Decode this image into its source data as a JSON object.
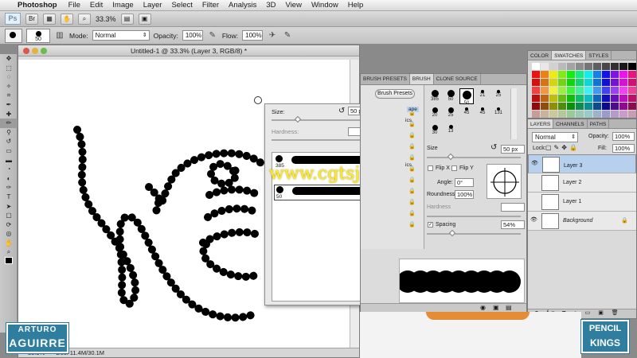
{
  "menubar": {
    "apple": "",
    "app_name": "Photoshop",
    "items": [
      "File",
      "Edit",
      "Image",
      "Layer",
      "Select",
      "Filter",
      "Analysis",
      "3D",
      "View",
      "Window",
      "Help"
    ]
  },
  "appbar": {
    "logo": "Ps",
    "zoom": "33.3%"
  },
  "options": {
    "brush_size": "50",
    "mode_label": "Mode:",
    "mode_value": "Normal",
    "opacity_label": "Opacity:",
    "opacity_value": "100%",
    "flow_label": "Flow:",
    "flow_value": "100%"
  },
  "document": {
    "title": "Untitled-1 @ 33.3% (Layer 3, RGB/8) *",
    "status_zoom": "33.3%",
    "status_doc": "Doc: 11.4M/30.1M"
  },
  "picker": {
    "size_label": "Size:",
    "size_value": "50 px",
    "hardness_label": "Hardness:",
    "presets": [
      {
        "num": "385"
      },
      {
        "num": "50"
      }
    ]
  },
  "brush_panel": {
    "tabs": [
      "BRUSH PRESETS",
      "BRUSH",
      "CLONE SOURCE"
    ],
    "presets_button": "Brush Presets",
    "side_fragments": [
      "ape",
      "ics",
      "ics"
    ],
    "thumbs": [
      {
        "num": "385",
        "d": 9
      },
      {
        "num": "50",
        "d": 9
      },
      {
        "num": "50",
        "d": 11
      },
      {
        "num": "21",
        "d": 4
      },
      {
        "num": "25",
        "d": 4
      },
      {
        "num": "20",
        "d": 7
      },
      {
        "num": "25",
        "d": 7
      },
      {
        "num": "45",
        "d": 4
      },
      {
        "num": "45",
        "d": 4
      },
      {
        "num": "131",
        "d": 4
      },
      {
        "num": "30",
        "d": 7
      },
      {
        "num": "13",
        "d": 5
      }
    ],
    "size_label": "Size",
    "size_value": "50 px",
    "flip_x": "Flip X",
    "flip_y": "Flip Y",
    "angle_label": "Angle:",
    "angle_value": "0°",
    "roundness_label": "Roundness:",
    "roundness_value": "100%",
    "hardness_label": "Hardness",
    "spacing_label": "Spacing",
    "spacing_value": "54%"
  },
  "swatch_panel": {
    "tabs": [
      "COLOR",
      "SWATCHES",
      "STYLES"
    ]
  },
  "layer_panel": {
    "tabs": [
      "LAYERS",
      "CHANNELS",
      "PATHS"
    ],
    "blend": "Normal",
    "opacity_label": "Opacity:",
    "opacity_value": "100%",
    "lock_label": "Lock:",
    "fill_label": "Fill:",
    "fill_value": "100%",
    "layers": [
      {
        "name": "Layer 3"
      },
      {
        "name": "Layer 2"
      },
      {
        "name": "Layer 1"
      },
      {
        "name": "Background"
      }
    ],
    "footer_icons": "fx"
  },
  "watermarks": {
    "url": "www.cgtsj.com",
    "left_line1": "ARTURO",
    "left_line2": "AGUIRRE",
    "right_line1": "PENCIL",
    "right_line2": "KINGS"
  },
  "colors": {
    "selected_layer": "#b7d0ee",
    "watermark_yellow": "#ffec1f",
    "brand_blue": "#2f7ea0"
  }
}
